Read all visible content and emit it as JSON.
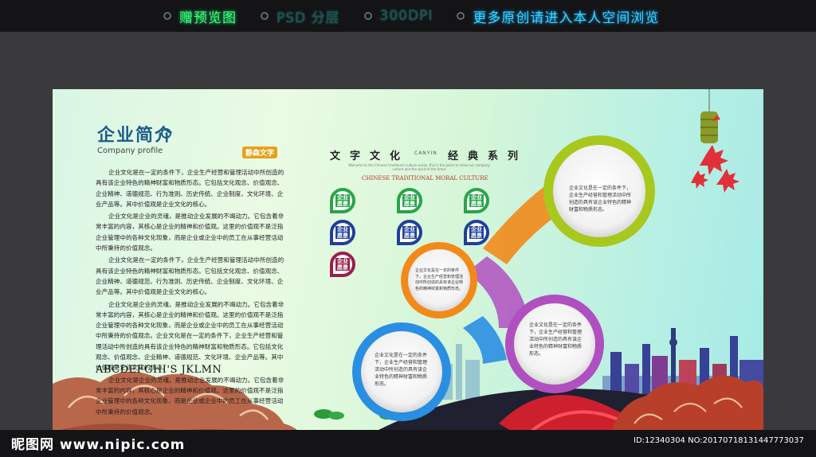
{
  "topbar": {
    "items": [
      "赠预览图",
      "PSD 分层",
      "300DPI",
      "更多原创请进入本人空间浏览"
    ]
  },
  "poster": {
    "title_cn": "企业简介",
    "title_en": "Company profile",
    "stamp": "静森文字",
    "paragraphs": [
      "企业文化是在一定的条件下，企业生产经营和管理活动中所创造的具有该企业特色的精神财富和物质形态。它包括文化观念、价值观念、企业精神、道德规范、行为准则、历史传统、企业制度、文化环境、企业产品等。其中价值观是企业文化的核心。",
      "企业文化是企业的灵魂，是推动企业发展的不竭动力。它包含着非常丰富的内容，其核心是企业的精神和价值观。这里的价值观不是泛指企业管理中的各种文化现象，而是企业或企业中的员工在从事经营活动中所秉持的价值观念。",
      "企业文化是在一定的条件下，企业生产经营和管理活动中所创造的具有该企业特色的精神财富和物质形态。它包括文化观念、价值观念、企业精神、道德规范、行为准则、历史传统、企业制度、文化环境、企业产品等。其中价值观是企业文化的核心。",
      "企业文化是企业的灵魂，是推动企业发展的不竭动力。它包含着非常丰富的内容，其核心是企业的精神和价值观。这里的价值观不是泛指企业管理中的各种文化现象，而是企业或企业中的员工在从事经营活动中所秉持的价值观念。企业文化是在一定的条件下，企业生产经营和管理活动中所创造的具有该企业特色的精神财富和物质形态。它包括文化观念、价值观念、企业精神、道德规范、文化环境、企业产品等。其中价值观是企业文化的核心。",
      "企业文化是企业的灵魂，是推动企业发展的不竭动力。它包含着非常丰富的内容，其核心是企业的精神和价值观。这里的价值观不是泛指企业管理中的各种文化现象，而是企业或企业中的员工在从事经营活动中所秉持的价值观念。"
    ],
    "alphabet": "ABCDEFGHI'S  JKLMN",
    "heading": "文字文化",
    "heading_small": "CANYIN",
    "heading2": "经典系列",
    "subtitle": "Welcome to the Chinese traditional culture series, this is the place to show our company culture and the spirit of the times",
    "subtitle_en": "CHINESE TRADITIONAL MORAL CULTURE",
    "tag_line1": "企业",
    "tag_line2": "愿景",
    "circle_text": "企业文化是在一定的条件下，企业生产经营和管理活动中所创造的具有该企业特色的精神财富和物质形态。"
  },
  "colors": {
    "green": "#a8c81e",
    "orange": "#f28a1b",
    "purple": "#b04fc0",
    "blue": "#2a8fe2",
    "tag_blue": "#1a9ad0",
    "tag_green": "#2aa44a",
    "tag_navy": "#1f3f9a",
    "tag_wine": "#9a1f4a"
  },
  "footer": {
    "logo": "昵图网 www.nipic.com",
    "id": "ID:12340304 NO:20170718131447773037"
  }
}
